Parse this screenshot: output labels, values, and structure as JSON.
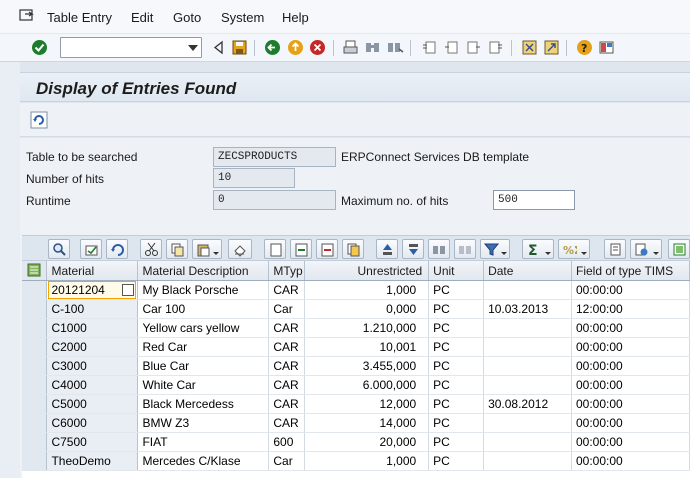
{
  "menu": {
    "items": [
      "Table Entry",
      "Edit",
      "Goto",
      "System",
      "Help"
    ]
  },
  "toolbar": {
    "command_field_value": "",
    "icons": [
      "enter-check-icon",
      "command-field-dropdown",
      "back-arrow-icon",
      "save-icon",
      "back-icon",
      "exit-icon",
      "cancel-icon",
      "print-icon",
      "find-icon",
      "find-next-icon",
      "first-page-icon",
      "previous-page-icon",
      "next-page-icon",
      "last-page-icon",
      "create-session-icon",
      "shortcut-icon",
      "help-icon",
      "layout-icon"
    ]
  },
  "page": {
    "title": "Display of Entries Found"
  },
  "form": {
    "table_label": "Table to be searched",
    "table_value": "ZECSPRODUCTS",
    "table_desc": "ERPConnect Services DB template",
    "hits_label": "Number of hits",
    "hits_value": "10",
    "runtime_label": "Runtime",
    "runtime_value": "0",
    "max_hits_label": "Maximum no. of hits",
    "max_hits_value": "500"
  },
  "grid": {
    "columns": [
      "Material",
      "Material Description",
      "MTyp",
      "Unrestricted",
      "Unit",
      "Date",
      "Field of type TIMS"
    ],
    "rows": [
      [
        "20121204",
        "My Black Porsche",
        "CAR",
        "1,000",
        "PC",
        "",
        "00:00:00"
      ],
      [
        "C-100",
        "Car 100",
        "Car",
        "0,000",
        "PC",
        "10.03.2013",
        "12:00:00"
      ],
      [
        "C1000",
        "Yellow cars yellow",
        "CAR",
        "1.210,000",
        "PC",
        "",
        "00:00:00"
      ],
      [
        "C2000",
        "Red Car",
        "CAR",
        "10,001",
        "PC",
        "",
        "00:00:00"
      ],
      [
        "C3000",
        "Blue Car",
        "CAR",
        "3.455,000",
        "PC",
        "",
        "00:00:00"
      ],
      [
        "C4000",
        "White Car",
        "CAR",
        "6.000,000",
        "PC",
        "",
        "00:00:00"
      ],
      [
        "C5000",
        "Black Mercedess",
        "CAR",
        "12,000",
        "PC",
        "30.08.2012",
        "00:00:00"
      ],
      [
        "C6000",
        "BMW Z3",
        "CAR",
        "14,000",
        "PC",
        "",
        "00:00:00"
      ],
      [
        "C7500",
        "FIAT",
        "600",
        "20,000",
        "PC",
        "",
        "00:00:00"
      ],
      [
        "TheoDemo",
        "Mercedes C/Klase",
        "Car",
        "1,000",
        "PC",
        "",
        "00:00:00"
      ]
    ]
  },
  "colors": {
    "accent_green": "#1e7d2c",
    "cancel_red": "#c62828",
    "focus_orange": "#f7a300"
  }
}
